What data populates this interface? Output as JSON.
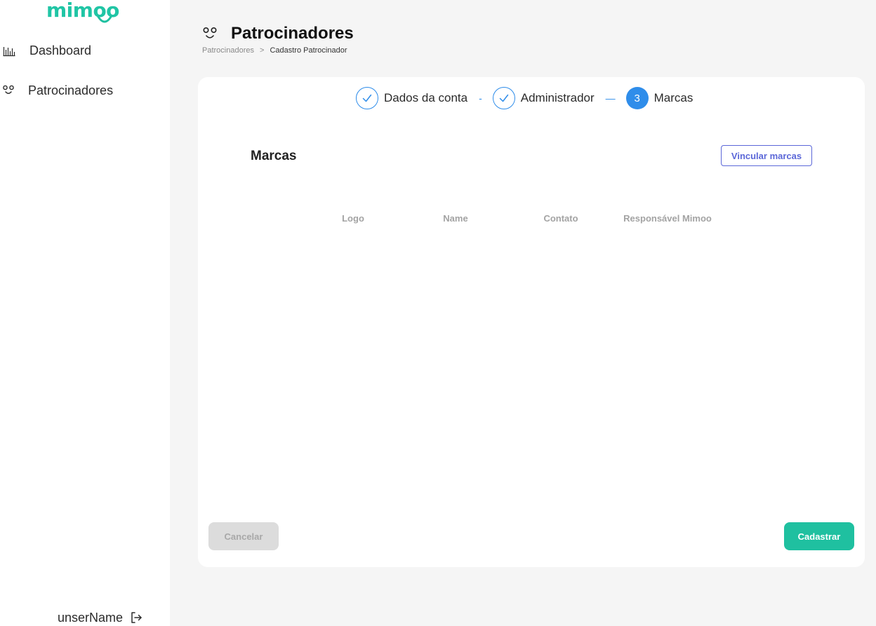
{
  "brand": {
    "logo_text": "mimoo",
    "accent_color": "#1fc0a0",
    "step_color": "#2f8dea",
    "link_color": "#5b67d8"
  },
  "sidebar": {
    "items": [
      {
        "label": "Dashboard",
        "icon": "bar-chart-icon"
      },
      {
        "label": "Patrocinadores",
        "icon": "face-icon"
      }
    ],
    "user": {
      "name": "unserName",
      "icon": "logout-icon"
    }
  },
  "header": {
    "title": "Patrocinadores",
    "icon": "face-icon",
    "breadcrumb": {
      "parent": "Patrocinadores",
      "separator": ">",
      "current": "Cadastro Patrocinador"
    }
  },
  "stepper": {
    "steps": [
      {
        "label": "Dados da conta",
        "status": "done",
        "icon": "check-icon"
      },
      {
        "label": "Administrador",
        "status": "done",
        "icon": "check-icon"
      },
      {
        "label": "Marcas",
        "status": "active",
        "number": "3"
      }
    ],
    "separators": [
      "-",
      "—"
    ]
  },
  "section": {
    "title": "Marcas",
    "link_button": "Vincular marcas"
  },
  "table": {
    "columns": [
      "Logo",
      "Name",
      "Contato",
      "Responsável Mimoo"
    ],
    "rows": []
  },
  "actions": {
    "cancel": "Cancelar",
    "submit": "Cadastrar"
  }
}
